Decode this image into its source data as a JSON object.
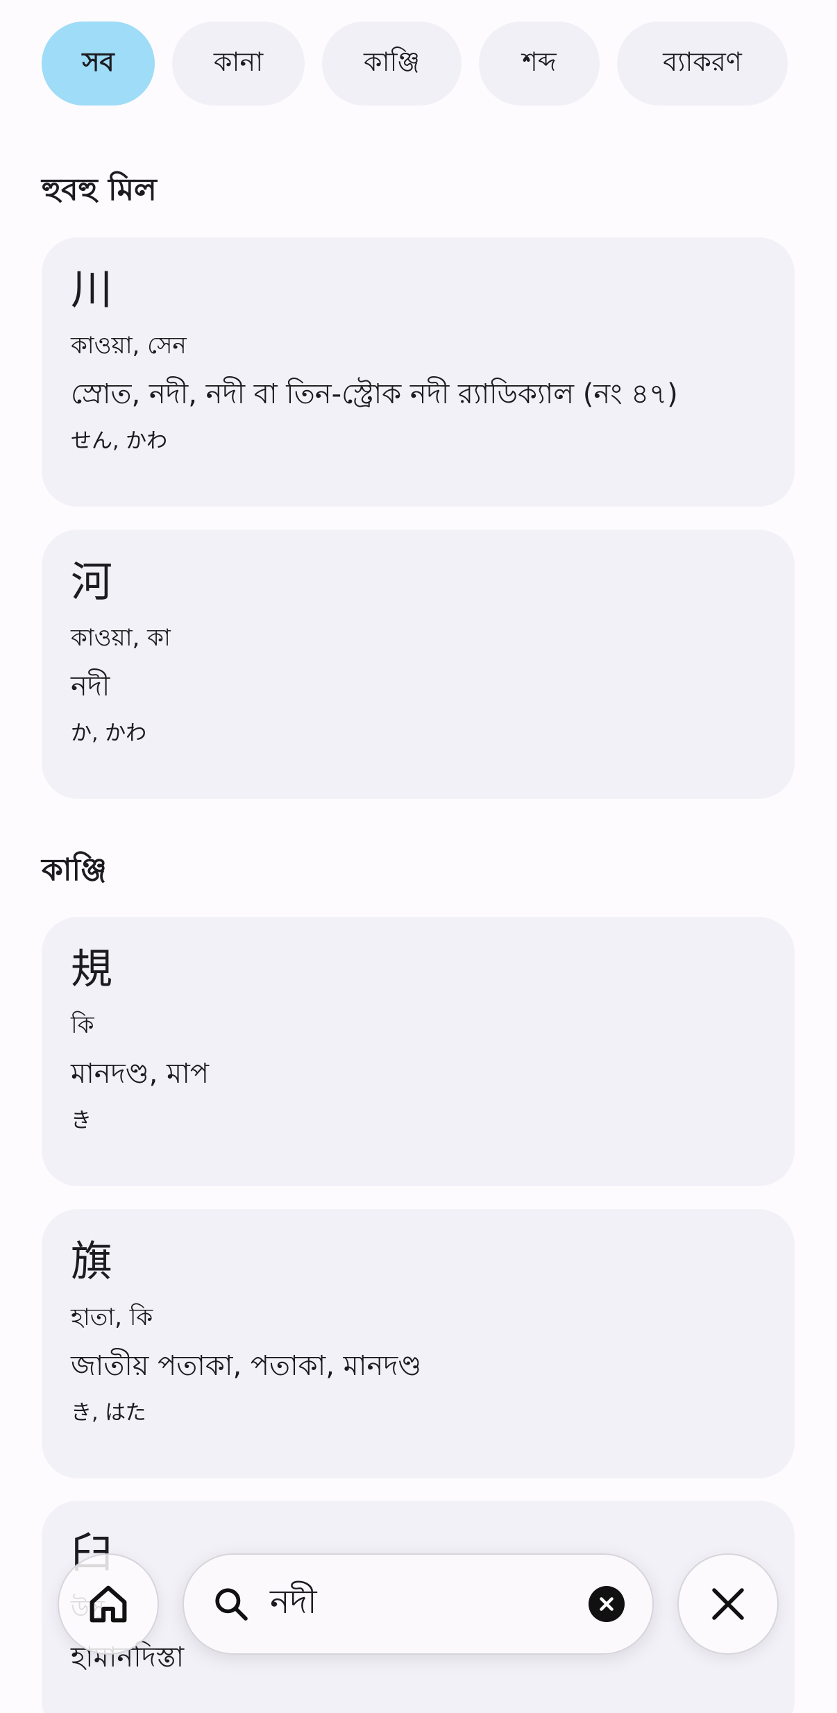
{
  "filters": [
    {
      "label": "সব",
      "active": true
    },
    {
      "label": "কানা",
      "active": false
    },
    {
      "label": "কাঞ্জি",
      "active": false
    },
    {
      "label": "শব্দ",
      "active": false
    },
    {
      "label": "ব্যাকরণ",
      "active": false
    }
  ],
  "sections": {
    "exact": {
      "title": "হুবহু মিল"
    },
    "kanji": {
      "title": "কাঞ্জি"
    }
  },
  "exact_cards": [
    {
      "glyph": "川",
      "reading": "কাওয়া, সেন",
      "meaning": "স্রোত, নদী, নদী বা তিন-স্ট্রোক নদী র‌্যাডিক্যাল (নং ৪৭)",
      "kana": "せん, かわ"
    },
    {
      "glyph": "河",
      "reading": "কাওয়া, কা",
      "meaning": "নদী",
      "kana": "か, かわ"
    }
  ],
  "kanji_cards": [
    {
      "glyph": "規",
      "reading": "কি",
      "meaning": "মানদণ্ড, মাপ",
      "kana": "き"
    },
    {
      "glyph": "旗",
      "reading": "হাতা, কি",
      "meaning": "জাতীয় পতাকা, পতাকা, মানদণ্ড",
      "kana": "き, はた"
    },
    {
      "glyph": "臼",
      "reading": "উসু",
      "meaning": "হামানদিস্তা",
      "kana": ""
    }
  ],
  "search": {
    "query": "নদী"
  },
  "icons": {
    "home": "home-icon",
    "search": "search-icon",
    "clear": "clear-circle-icon",
    "close": "close-icon"
  },
  "colors": {
    "active_chip": "#9edcf7",
    "chip": "#f2f0f7",
    "card": "#f3f1f8",
    "background": "#fdfbfd"
  }
}
